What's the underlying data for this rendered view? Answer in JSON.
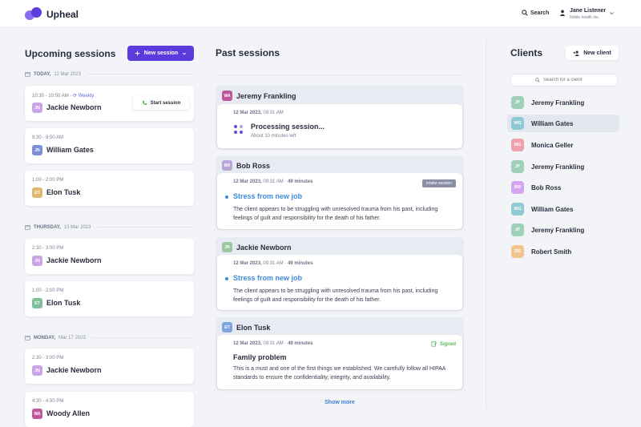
{
  "app": {
    "brand": "Upheal"
  },
  "header": {
    "search_label": "Search",
    "user_name": "Jane Listener",
    "user_org": "Noble health inc."
  },
  "upcoming": {
    "title": "Upcoming sessions",
    "new_session_label": "New session",
    "days": [
      {
        "label": "TODAY,",
        "date": "12 Mar 2023",
        "sessions": [
          {
            "time": "10:30 - 10:50 AM",
            "recurrence": "Weekly",
            "initials": "JN",
            "name": "Jackie Newborn",
            "action": "Start session",
            "color": "#c9a4e6"
          },
          {
            "time": "9:30 - 9:50 AM",
            "initials": "JN",
            "name": "William Gates",
            "color": "#7c8fd6"
          },
          {
            "time": "1:00 - 2:00 PM",
            "initials": "ET",
            "name": "Elon Tusk",
            "color": "#e0b86e"
          }
        ]
      },
      {
        "label": "THURSDAY,",
        "date": "13 Mar 2023",
        "sessions": [
          {
            "time": "2:30 - 3:00 PM",
            "initials": "JN",
            "name": "Jackie Newborn",
            "color": "#c9a4e6"
          },
          {
            "time": "1:00 - 2:00 PM",
            "initials": "ET",
            "name": "Elon Tusk",
            "color": "#7fbf9a"
          }
        ]
      },
      {
        "label": "MONDAY,",
        "date": "Mar 17 2023",
        "sessions": [
          {
            "time": "2:30 - 3:00 PM",
            "initials": "JN",
            "name": "Jackie Newborn",
            "color": "#c9a4e6"
          },
          {
            "time": "4:30 - 4:50 PM",
            "initials": "WA",
            "name": "Woody Allen",
            "color": "#c0579b"
          }
        ]
      }
    ]
  },
  "past": {
    "title": "Past sessions",
    "groups": [
      {
        "initials": "WA",
        "name": "Jeremy Frankling",
        "color": "#c0579b",
        "date": "12 Mar 2023,",
        "time": "09:31 AM",
        "status_title": "Processing session...",
        "status_sub": "About 10 minutes left"
      },
      {
        "initials": "BR",
        "name": "Bob Ross",
        "color": "#b9a6d6",
        "date": "12 Mar 2023,",
        "time": "09:31 AM",
        "duration": "49 minutes",
        "badge": "Intake session",
        "title": "Stress from new job",
        "text": "The client appears to be struggling with unresolved trauma from his past, including feelings of guilt and responsibility for the death of his father."
      },
      {
        "initials": "JN",
        "name": "Jackie Newborn",
        "color": "#9cc7a0",
        "date": "12 Mar 2023,",
        "time": "09:31 AM",
        "duration": "49 minutes",
        "title": "Stress from new job",
        "text": "The client appears to be struggling with unresolved trauma from his past, including feelings of guilt and responsibility for the death of his father."
      },
      {
        "initials": "ET",
        "name": "Elon Tusk",
        "color": "#7ea6dc",
        "date": "12 Mar 2023,",
        "time": "09:31 AM",
        "duration": "49 minutes",
        "badge": "Signed",
        "title": "Family problem",
        "text": "This is a must and one of the first things we established. We carefully follow all HIPAA standards to ensure  the confidentiality, integrity, and availability."
      }
    ],
    "show_more": "Show more"
  },
  "clients": {
    "title": "Clients",
    "new_client_label": "New client",
    "search_placeholder": "Search for a client",
    "list": [
      {
        "initials": "JF",
        "name": "Jeremy Frankling",
        "color": "#9fd1b8"
      },
      {
        "initials": "WG",
        "name": "William Gates",
        "color": "#8fc9d4"
      },
      {
        "initials": "MG",
        "name": "Monica Geller",
        "color": "#f0a0a8"
      },
      {
        "initials": "JF",
        "name": "Jeremy Frankling",
        "color": "#9fd1b8"
      },
      {
        "initials": "BR",
        "name": "Bob Ross",
        "color": "#d4a6f0"
      },
      {
        "initials": "WG",
        "name": "William Gates",
        "color": "#8fc9d4"
      },
      {
        "initials": "JF",
        "name": "Jeremy Frankling",
        "color": "#9fd1b8"
      },
      {
        "initials": "RS",
        "name": "Robert Smith",
        "color": "#f3c58e"
      }
    ]
  }
}
